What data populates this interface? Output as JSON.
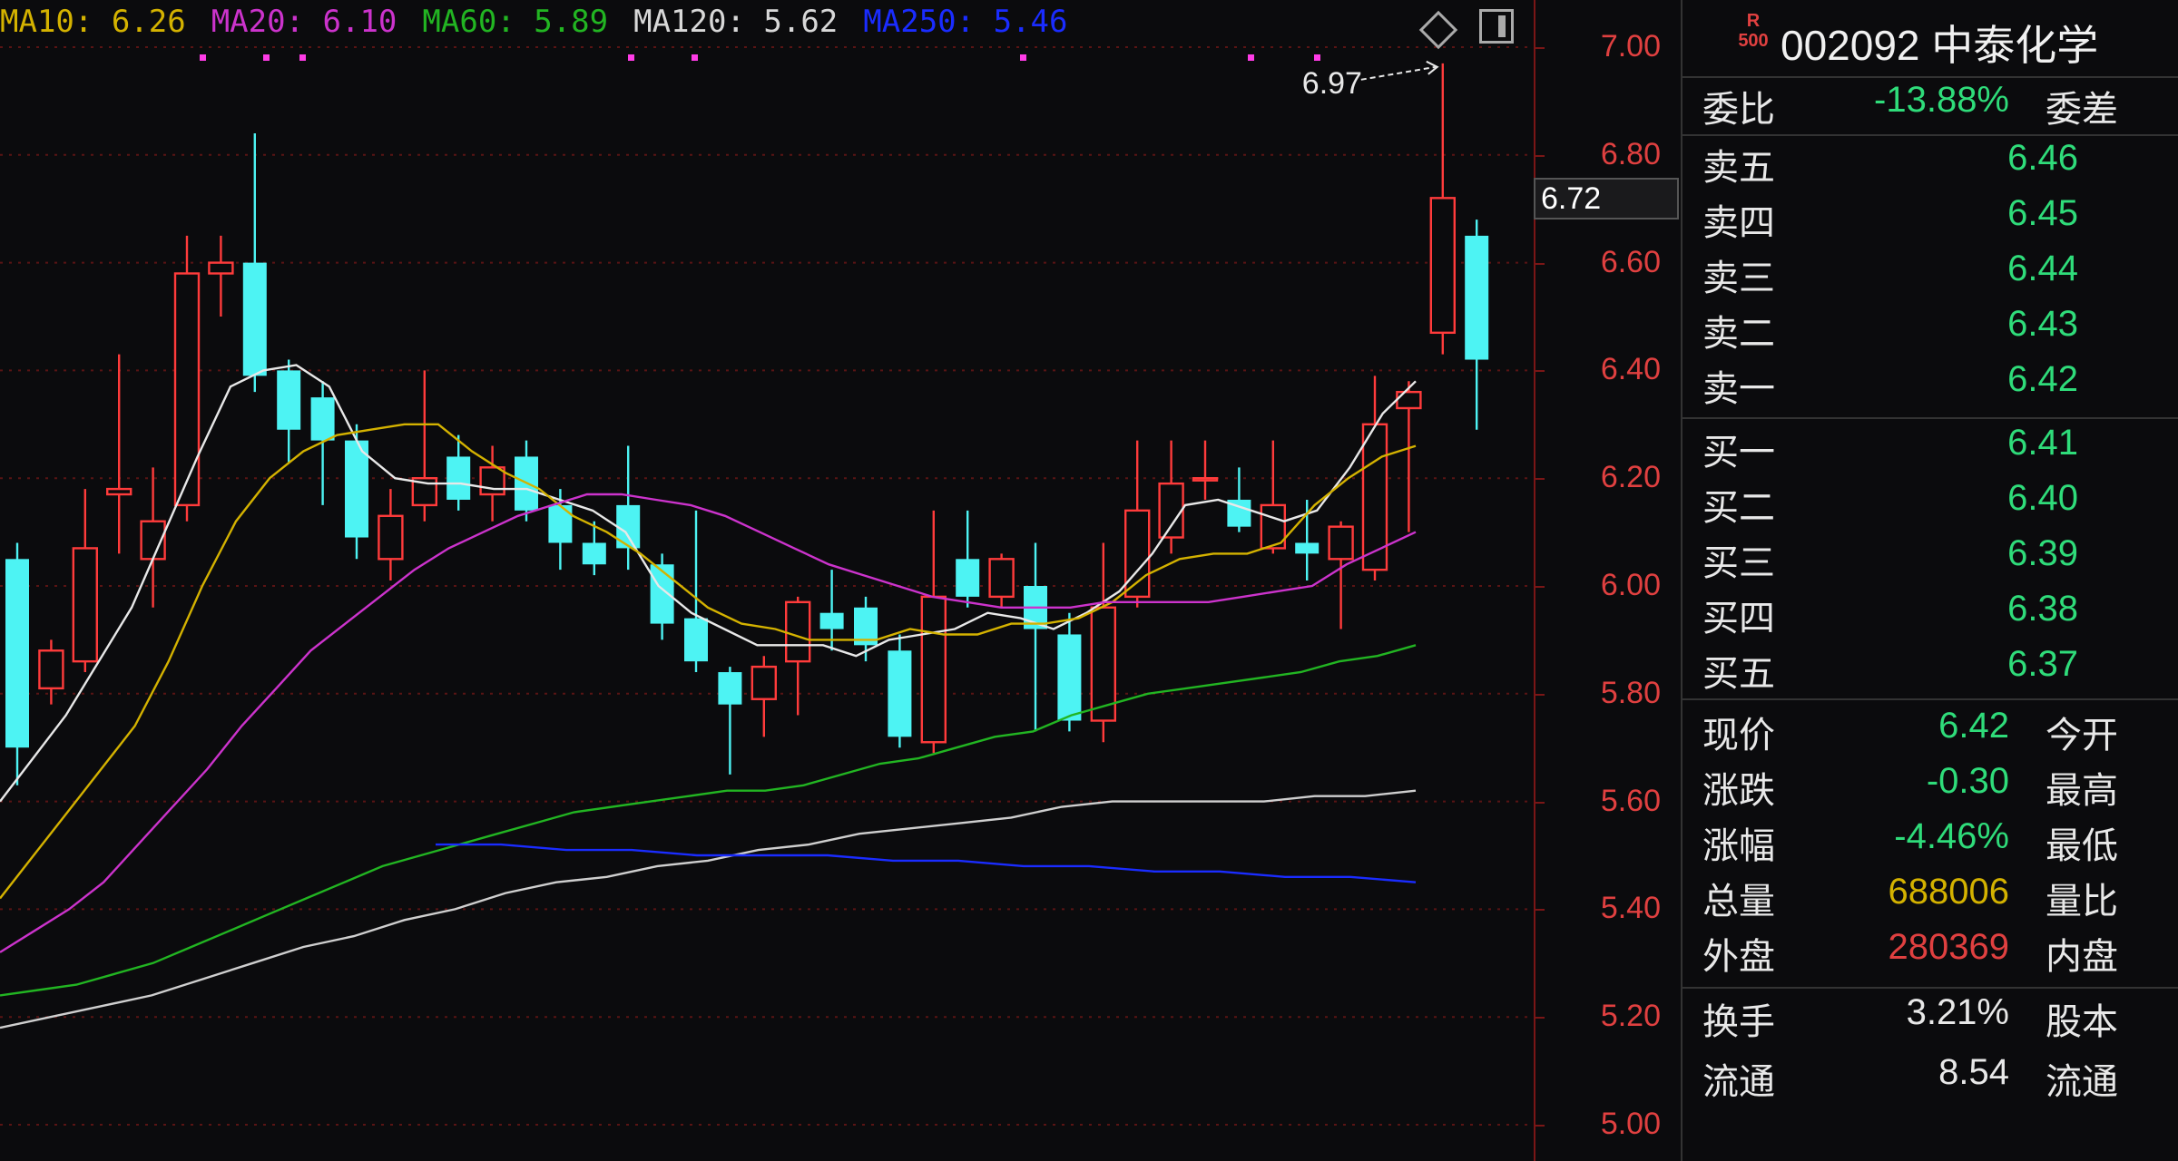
{
  "legend": [
    {
      "label": "MA10: 6.26",
      "color": "#d4b200"
    },
    {
      "label": "MA20: 6.10",
      "color": "#cc33cc"
    },
    {
      "label": "MA60: 5.89",
      "color": "#22b522"
    },
    {
      "label": "MA120: 5.62",
      "color": "#d8d8d8"
    },
    {
      "label": "MA250: 5.46",
      "color": "#1a2cff"
    }
  ],
  "icons": {
    "diamond": "diamond-icon",
    "panel_toggle": "panel-toggle-icon"
  },
  "price_axis": {
    "ticks": [
      "7.00",
      "6.80",
      "6.60",
      "6.40",
      "6.20",
      "6.00",
      "5.80",
      "5.60",
      "5.40",
      "5.20",
      "5.00"
    ],
    "current_tag": "6.72"
  },
  "high_marker": "6.97",
  "chart_data": {
    "type": "candlestick",
    "ylim": [
      5.0,
      7.0
    ],
    "candles": [
      {
        "o": 6.05,
        "c": 5.7,
        "h": 6.08,
        "l": 5.63
      },
      {
        "o": 5.81,
        "c": 5.88,
        "h": 5.9,
        "l": 5.78
      },
      {
        "o": 5.86,
        "c": 6.07,
        "h": 6.18,
        "l": 5.84
      },
      {
        "o": 6.17,
        "c": 6.18,
        "h": 6.43,
        "l": 6.06
      },
      {
        "o": 6.05,
        "c": 6.12,
        "h": 6.22,
        "l": 5.96
      },
      {
        "o": 6.15,
        "c": 6.58,
        "h": 6.65,
        "l": 6.12
      },
      {
        "o": 6.58,
        "c": 6.6,
        "h": 6.65,
        "l": 6.5
      },
      {
        "o": 6.6,
        "c": 6.39,
        "h": 6.84,
        "l": 6.36
      },
      {
        "o": 6.4,
        "c": 6.29,
        "h": 6.42,
        "l": 6.23
      },
      {
        "o": 6.35,
        "c": 6.27,
        "h": 6.38,
        "l": 6.15
      },
      {
        "o": 6.27,
        "c": 6.09,
        "h": 6.3,
        "l": 6.05
      },
      {
        "o": 6.05,
        "c": 6.13,
        "h": 6.18,
        "l": 6.01
      },
      {
        "o": 6.15,
        "c": 6.2,
        "h": 6.4,
        "l": 6.12
      },
      {
        "o": 6.24,
        "c": 6.16,
        "h": 6.28,
        "l": 6.14
      },
      {
        "o": 6.17,
        "c": 6.22,
        "h": 6.26,
        "l": 6.12
      },
      {
        "o": 6.24,
        "c": 6.14,
        "h": 6.27,
        "l": 6.12
      },
      {
        "o": 6.15,
        "c": 6.08,
        "h": 6.18,
        "l": 6.03
      },
      {
        "o": 6.08,
        "c": 6.04,
        "h": 6.12,
        "l": 6.02
      },
      {
        "o": 6.15,
        "c": 6.07,
        "h": 6.26,
        "l": 6.03
      },
      {
        "o": 6.04,
        "c": 5.93,
        "h": 6.06,
        "l": 5.9
      },
      {
        "o": 5.94,
        "c": 5.86,
        "h": 6.14,
        "l": 5.84
      },
      {
        "o": 5.84,
        "c": 5.78,
        "h": 5.85,
        "l": 5.65
      },
      {
        "o": 5.79,
        "c": 5.85,
        "h": 5.87,
        "l": 5.72
      },
      {
        "o": 5.86,
        "c": 5.97,
        "h": 5.98,
        "l": 5.76
      },
      {
        "o": 5.95,
        "c": 5.92,
        "h": 6.03,
        "l": 5.88
      },
      {
        "o": 5.96,
        "c": 5.89,
        "h": 5.98,
        "l": 5.86
      },
      {
        "o": 5.88,
        "c": 5.72,
        "h": 5.91,
        "l": 5.7
      },
      {
        "o": 5.71,
        "c": 5.98,
        "h": 6.14,
        "l": 5.69
      },
      {
        "o": 6.05,
        "c": 5.98,
        "h": 6.14,
        "l": 5.96
      },
      {
        "o": 5.98,
        "c": 6.05,
        "h": 6.06,
        "l": 5.96
      },
      {
        "o": 6.0,
        "c": 5.92,
        "h": 6.08,
        "l": 5.73
      },
      {
        "o": 5.91,
        "c": 5.75,
        "h": 5.95,
        "l": 5.73
      },
      {
        "o": 5.75,
        "c": 5.96,
        "h": 6.08,
        "l": 5.71
      },
      {
        "o": 5.98,
        "c": 6.14,
        "h": 6.27,
        "l": 5.96
      },
      {
        "o": 6.09,
        "c": 6.19,
        "h": 6.27,
        "l": 6.06
      },
      {
        "o": 6.2,
        "c": 6.2,
        "h": 6.27,
        "l": 6.16
      },
      {
        "o": 6.16,
        "c": 6.11,
        "h": 6.22,
        "l": 6.1
      },
      {
        "o": 6.07,
        "c": 6.15,
        "h": 6.27,
        "l": 6.06
      },
      {
        "o": 6.08,
        "c": 6.06,
        "h": 6.16,
        "l": 6.01
      },
      {
        "o": 6.05,
        "c": 6.11,
        "h": 6.12,
        "l": 5.92
      },
      {
        "o": 6.03,
        "c": 6.3,
        "h": 6.39,
        "l": 6.01
      },
      {
        "o": 6.33,
        "c": 6.36,
        "h": 6.38,
        "l": 6.1
      },
      {
        "o": 6.47,
        "c": 6.72,
        "h": 6.97,
        "l": 6.43
      },
      {
        "o": 6.65,
        "c": 6.42,
        "h": 6.68,
        "l": 6.29
      }
    ],
    "series": [
      {
        "values": [
          5.6,
          5.68,
          5.76,
          5.86,
          5.96,
          6.1,
          6.24,
          6.37,
          6.4,
          6.41,
          6.37,
          6.25,
          6.2,
          6.19,
          6.19,
          6.18,
          6.18,
          6.16,
          6.14,
          6.1,
          6.0,
          5.95,
          5.92,
          5.89,
          5.89,
          5.89,
          5.87,
          5.9,
          5.91,
          5.92,
          5.95,
          5.94,
          5.92,
          5.95,
          5.99,
          6.06,
          6.15,
          6.16,
          6.14,
          6.12,
          6.14,
          6.22,
          6.32,
          6.38
        ]
      },
      {
        "values": [
          5.42,
          5.5,
          5.58,
          5.66,
          5.74,
          5.86,
          6.0,
          6.12,
          6.2,
          6.25,
          6.28,
          6.29,
          6.3,
          6.3,
          6.25,
          6.21,
          6.18,
          6.13,
          6.1,
          6.06,
          6.01,
          5.96,
          5.93,
          5.92,
          5.9,
          5.9,
          5.9,
          5.92,
          5.91,
          5.91,
          5.93,
          5.93,
          5.94,
          5.97,
          6.02,
          6.05,
          6.06,
          6.06,
          6.08,
          6.15,
          6.2,
          6.24,
          6.26
        ]
      },
      {
        "values": [
          5.32,
          5.36,
          5.4,
          5.45,
          5.52,
          5.59,
          5.66,
          5.74,
          5.81,
          5.88,
          5.93,
          5.98,
          6.03,
          6.07,
          6.1,
          6.13,
          6.15,
          6.17,
          6.17,
          6.16,
          6.15,
          6.13,
          6.1,
          6.07,
          6.04,
          6.02,
          6.0,
          5.98,
          5.97,
          5.96,
          5.96,
          5.96,
          5.97,
          5.97,
          5.97,
          5.97,
          5.98,
          5.99,
          6.0,
          6.04,
          6.07,
          6.1
        ]
      },
      {
        "values": [
          5.24,
          5.25,
          5.26,
          5.28,
          5.3,
          5.33,
          5.36,
          5.39,
          5.42,
          5.45,
          5.48,
          5.5,
          5.52,
          5.54,
          5.56,
          5.58,
          5.59,
          5.6,
          5.61,
          5.62,
          5.62,
          5.63,
          5.65,
          5.67,
          5.68,
          5.7,
          5.72,
          5.73,
          5.76,
          5.78,
          5.8,
          5.81,
          5.82,
          5.83,
          5.84,
          5.86,
          5.87,
          5.89
        ]
      },
      {
        "values": [
          5.18,
          5.2,
          5.22,
          5.24,
          5.27,
          5.3,
          5.33,
          5.35,
          5.38,
          5.4,
          5.43,
          5.45,
          5.46,
          5.48,
          5.49,
          5.51,
          5.52,
          5.54,
          5.55,
          5.56,
          5.57,
          5.59,
          5.6,
          5.6,
          5.6,
          5.6,
          5.61,
          5.61,
          5.62
        ]
      },
      {
        "values": [
          5.52,
          5.52,
          5.51,
          5.51,
          5.5,
          5.5,
          5.5,
          5.49,
          5.49,
          5.48,
          5.48,
          5.47,
          5.47,
          5.46,
          5.46,
          5.45
        ]
      }
    ]
  },
  "quote": {
    "r_badge": "R",
    "r_badge_sub": "500",
    "title": "002092 中泰化学",
    "weibi_label": "委比",
    "weibi_value": "-13.88%",
    "weicha_label": "委差",
    "sells": [
      {
        "label": "卖五",
        "price": "6.46"
      },
      {
        "label": "卖四",
        "price": "6.45"
      },
      {
        "label": "卖三",
        "price": "6.44"
      },
      {
        "label": "卖二",
        "price": "6.43"
      },
      {
        "label": "卖一",
        "price": "6.42"
      }
    ],
    "buys": [
      {
        "label": "买一",
        "price": "6.41"
      },
      {
        "label": "买二",
        "price": "6.40"
      },
      {
        "label": "买三",
        "price": "6.39"
      },
      {
        "label": "买四",
        "price": "6.38"
      },
      {
        "label": "买五",
        "price": "6.37"
      }
    ],
    "stats": [
      {
        "label": "现价",
        "value": "6.42",
        "extra": "今开",
        "color": "#2fdc7a"
      },
      {
        "label": "涨跌",
        "value": "-0.30",
        "extra": "最高",
        "color": "#2fdc7a"
      },
      {
        "label": "涨幅",
        "value": "-4.46%",
        "extra": "最低",
        "color": "#2fdc7a"
      },
      {
        "label": "总量",
        "value": "688006",
        "extra": "量比",
        "color": "#d4b200"
      },
      {
        "label": "外盘",
        "value": "280369",
        "extra": "内盘",
        "color": "#e04040"
      }
    ],
    "turnover": {
      "label": "换手",
      "value": "3.21%",
      "extra": "股本"
    },
    "cut_row": {
      "label": "流通",
      "value": "8.54",
      "extra": "流通"
    }
  }
}
